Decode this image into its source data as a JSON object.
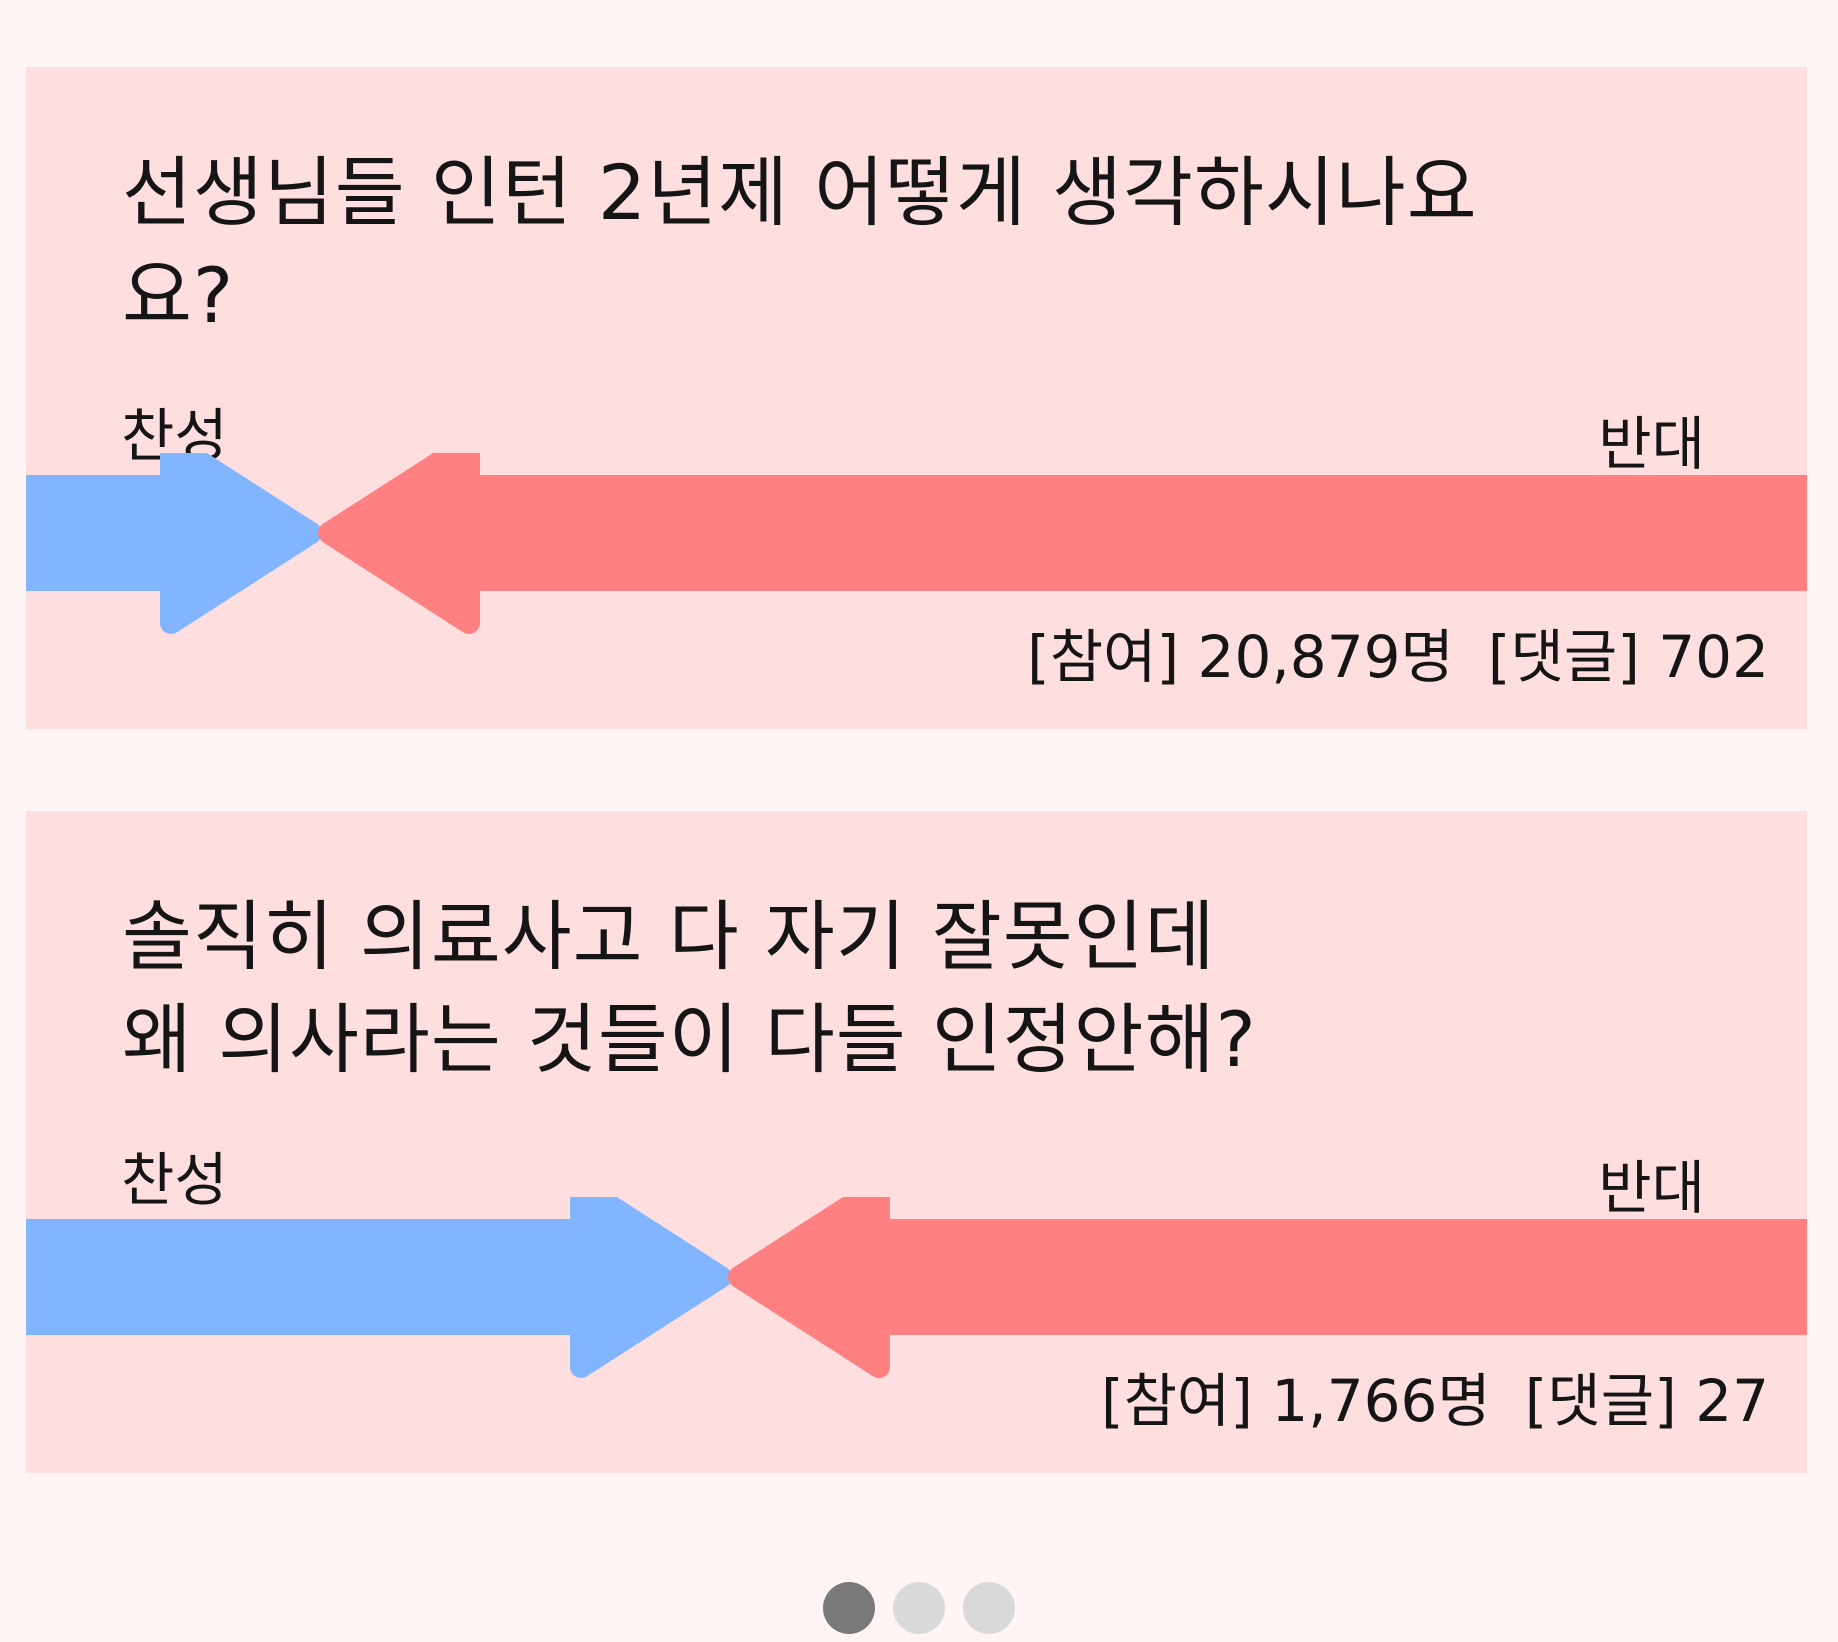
{
  "colors": {
    "background": "#fff5f4",
    "card": "#ffdedf",
    "agree": "#82b5ff",
    "oppose": "#ff8080",
    "dot_active": "#7a7a7a",
    "dot_inactive": "#d9d9d9"
  },
  "polls": [
    {
      "question_line1": "선생님들 인턴 2년제 어떻게 생각하시나요",
      "question_line2": "요?",
      "agree_label": "찬성",
      "oppose_label": "반대",
      "agree_share": 0.16,
      "participants_label": "[참여]",
      "participants_value": "20,879명",
      "comments_label": "[댓글]",
      "comments_value": "702"
    },
    {
      "question_line1": "솔직히 의료사고 다 자기 잘못인데",
      "question_line2": "왜 의사라는 것들이 다들 인정안해?",
      "agree_label": "찬성",
      "oppose_label": "반대",
      "agree_share": 0.39,
      "participants_label": "[참여]",
      "participants_value": "1,766명",
      "comments_label": "[댓글]",
      "comments_value": "27"
    }
  ],
  "pagination": {
    "total": 3,
    "current": 1
  }
}
